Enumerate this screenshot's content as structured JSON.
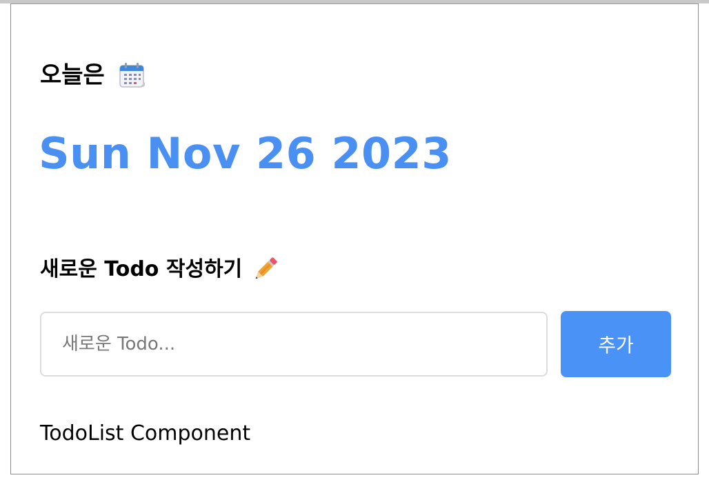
{
  "header": {
    "today_label": "오늘은",
    "icon": "calendar-icon"
  },
  "date": {
    "text": "Sun Nov 26 2023",
    "color": "#4a90f2"
  },
  "new_todo": {
    "heading": "새로운 Todo 작성하기",
    "icon": "pencil-icon",
    "input_placeholder": "새로운 Todo...",
    "input_value": "",
    "add_button_label": "추가",
    "button_color": "#4a92f6"
  },
  "todolist": {
    "label": "TodoList Component"
  }
}
